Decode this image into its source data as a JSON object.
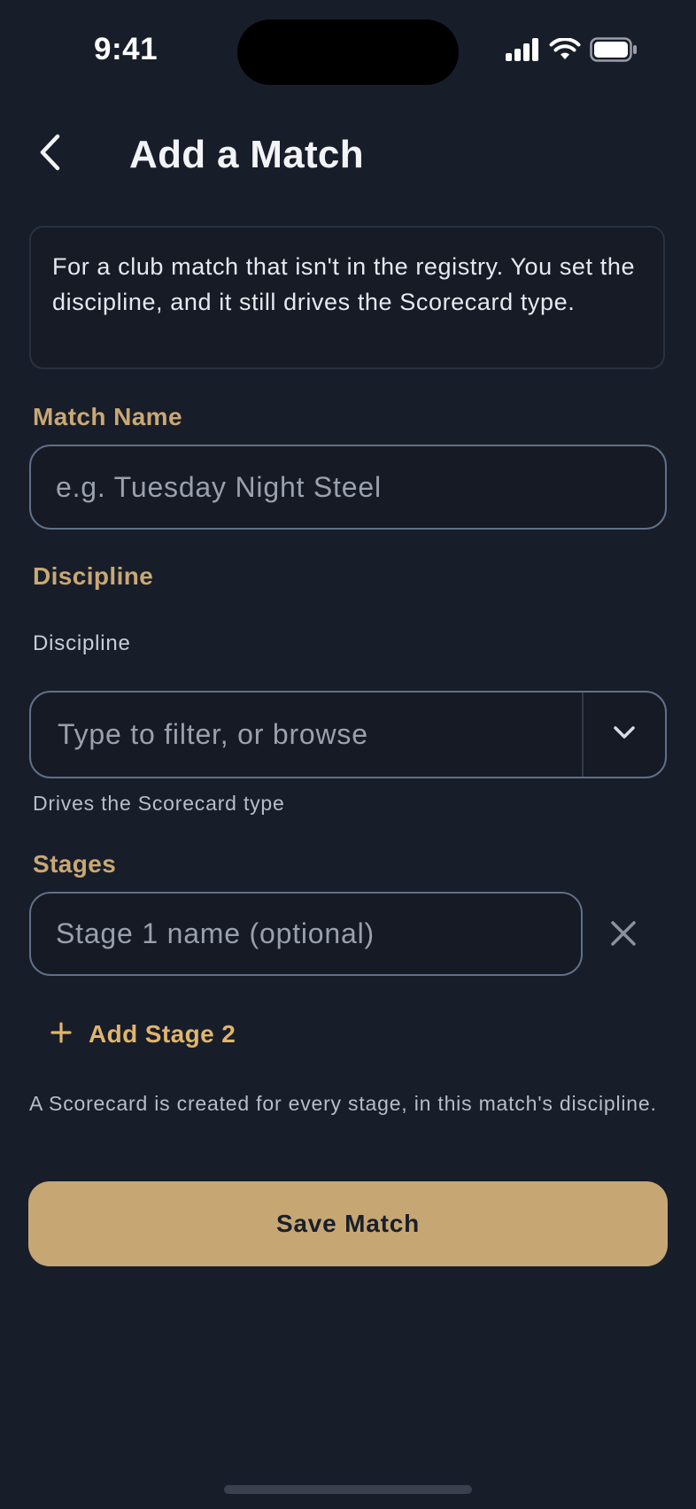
{
  "status_bar": {
    "time": "9:41",
    "icons": [
      "cellular-signal-icon",
      "wifi-icon",
      "battery-icon"
    ]
  },
  "header": {
    "back_icon": "chevron-left-icon",
    "title": "Add a Match"
  },
  "info_card": {
    "text": "For a club match that isn't in the registry. You set the discipline, and it still drives the Scorecard type."
  },
  "match_name": {
    "label": "Match Name",
    "value": "",
    "placeholder": "e.g. Tuesday Night Steel"
  },
  "discipline": {
    "section_label": "Discipline",
    "field_label": "Discipline",
    "value": "",
    "placeholder": "Type to filter, or browse",
    "toggle_icon": "chevron-down-icon",
    "helper": "Drives the Scorecard type"
  },
  "stages": {
    "label": "Stages",
    "items": [
      {
        "value": "",
        "placeholder": "Stage 1 name (optional)",
        "remove_icon": "close-icon"
      }
    ],
    "add_label": "Add Stage 2",
    "add_icon": "plus-icon",
    "footnote": "A Scorecard is created for every stage, in this match's discipline."
  },
  "actions": {
    "save_label": "Save Match"
  },
  "colors": {
    "background": "#181d2a",
    "accent": "#c6a774",
    "section_label": "#c9a874",
    "input_border": "#5f7088",
    "add_link": "#e0b56c"
  }
}
